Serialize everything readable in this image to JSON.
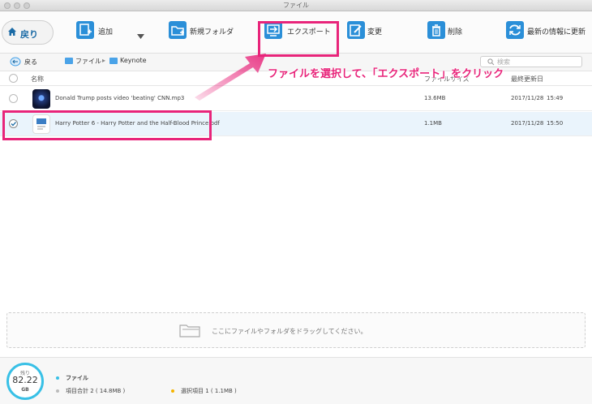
{
  "window": {
    "title": "ファイル"
  },
  "toolbar": {
    "back_label": "戻り",
    "add_label": "追加",
    "new_folder_label": "新規フォルダ",
    "export_label": "エクスポート",
    "edit_label": "変更",
    "delete_label": "削除",
    "refresh_label": "最新の情報に更新"
  },
  "nav": {
    "back_label": "戻る",
    "breadcrumb": [
      "ファイル",
      "Keynote"
    ],
    "search_placeholder": "検索"
  },
  "table": {
    "headers": {
      "name": "名称",
      "size": "ファイルサイズ",
      "date": "最終更新日"
    },
    "rows": [
      {
        "name": "Donald Trump posts video 'beating' CNN.mp3",
        "size": "13.6MB",
        "date": "2017/11/28",
        "time": "15:49",
        "selected": false
      },
      {
        "name": "Harry Potter 6 - Harry Potter and the Half-Blood Prince.pdf",
        "size": "1.1MB",
        "date": "2017/11/28",
        "time": "15:50",
        "selected": true
      }
    ]
  },
  "annotation": "ファイルを選択して、「エクスポート」をクリック",
  "dropzone": {
    "text": "ここにファイルやフォルダをドラッグしてください。"
  },
  "footer": {
    "storage_label": "残り",
    "storage_value": "82.22",
    "storage_unit": "GB",
    "category": "ファイル",
    "total_items": "項目合計 2 ( 14.8MB )",
    "selected_items": "選択項目 1 ( 1.1MB )"
  },
  "colors": {
    "accent": "#2b8fd8",
    "highlight": "#e8247a",
    "storage_ring": "#38c0e6"
  },
  "icons": [
    "home-icon",
    "add-file-icon",
    "dropdown-arrow-icon",
    "new-folder-icon",
    "export-icon",
    "edit-icon",
    "trash-icon",
    "refresh-icon",
    "folder-icon",
    "search-icon",
    "checkbox-icon",
    "album-art-icon",
    "pdf-thumbnail-icon",
    "drop-folder-icon"
  ]
}
